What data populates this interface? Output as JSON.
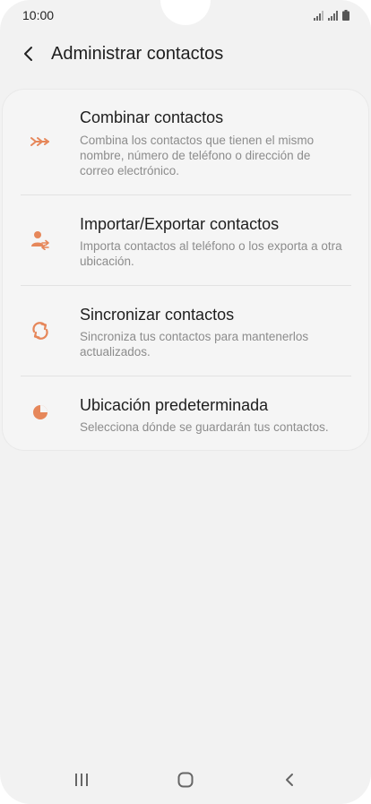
{
  "status_bar": {
    "time": "10:00",
    "icons": [
      "signal-icon",
      "signal-icon",
      "battery-icon"
    ]
  },
  "header": {
    "back_icon": "chevron-left-icon",
    "title": "Administrar contactos"
  },
  "colors": {
    "accent": "#e6875a",
    "background": "#f2f2f2",
    "title_text": "#1e1e1e",
    "secondary_text": "#8c8c8c"
  },
  "menu": {
    "items": [
      {
        "icon": "merge-icon",
        "title": "Combinar contactos",
        "description": "Combina los contactos que tienen el mismo nombre, número de teléfono o dirección de correo electrónico."
      },
      {
        "icon": "import-export-icon",
        "title": "Importar/Exportar contactos",
        "description": "Importa contactos al teléfono o los exporta a otra ubicación."
      },
      {
        "icon": "sync-icon",
        "title": "Sincronizar contactos",
        "description": "Sincroniza tus contactos para mantenerlos actualizados."
      },
      {
        "icon": "storage-location-icon",
        "title": "Ubicación predeterminada",
        "description": "Selecciona dónde se guardarán tus contactos."
      }
    ]
  },
  "nav_bar": {
    "recents_icon": "recents-icon",
    "home_icon": "home-icon",
    "back_icon": "back-icon"
  }
}
